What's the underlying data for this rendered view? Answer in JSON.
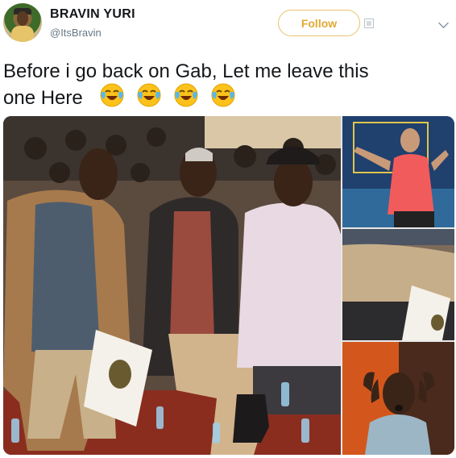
{
  "user": {
    "name": "BRAVIN YURI",
    "handle": "@ItsBravin",
    "follow_label": "Follow"
  },
  "tweet": {
    "text_line1": "Before i go back on Gab, Let me leave this",
    "text_line2": "one Here",
    "emojis": [
      "face-with-tears-of-joy-icon",
      "face-with-tears-of-joy-icon",
      "face-with-tears-of-joy-icon",
      "face-with-tears-of-joy-icon"
    ]
  },
  "colors": {
    "follow_accent": "#e3a932",
    "text": "#14171a",
    "muted": "#657786"
  }
}
